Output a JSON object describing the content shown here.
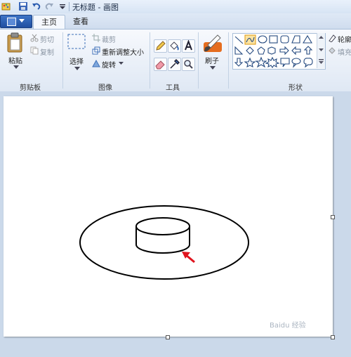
{
  "window": {
    "title": "无标题 - 画图"
  },
  "tabs": {
    "home": "主页",
    "view": "查看"
  },
  "clipboard": {
    "paste": "粘贴",
    "cut": "剪切",
    "copy": "复制",
    "group": "剪贴板"
  },
  "image": {
    "select": "选择",
    "crop": "裁剪",
    "resize": "重新调整大小",
    "rotate": "旋转",
    "group": "图像"
  },
  "tools": {
    "group": "工具"
  },
  "brushes": {
    "label": "刷子"
  },
  "shapes": {
    "group": "形状",
    "outline": "轮廓",
    "fill": "填充"
  },
  "watermark": "Baidu 经验",
  "colors": {
    "annotation_arrow": "#e0141e"
  }
}
